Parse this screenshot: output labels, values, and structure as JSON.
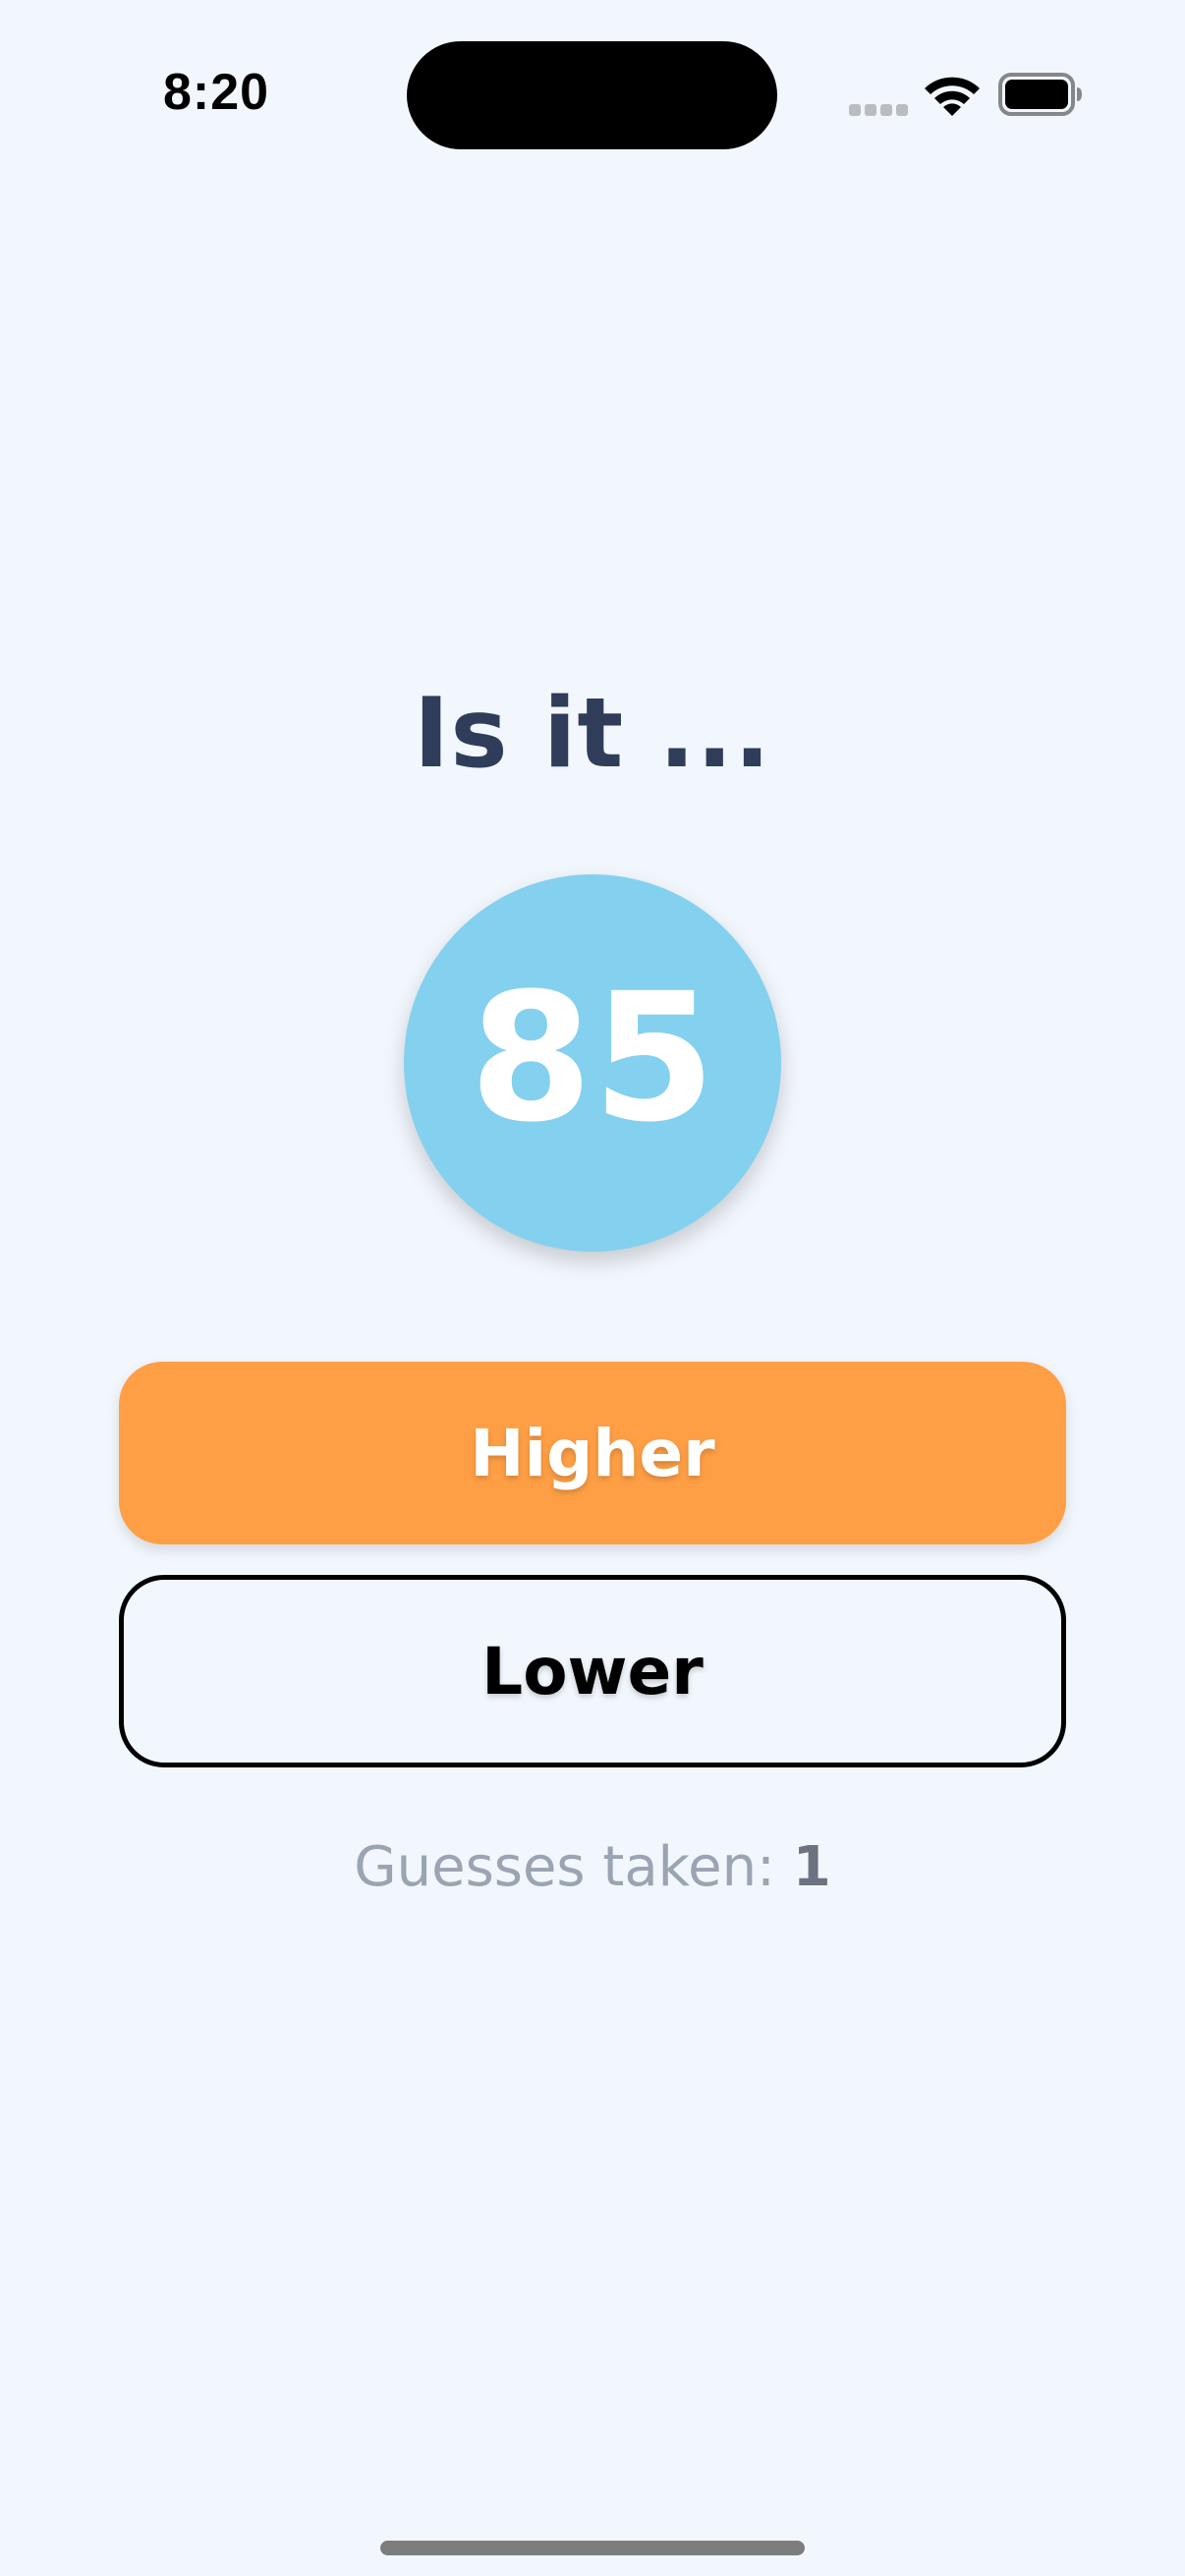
{
  "status_bar": {
    "time": "8:20",
    "icons": [
      "cellular-signal-icon",
      "wifi-icon",
      "battery-icon"
    ]
  },
  "game": {
    "prompt": "Is it ...",
    "guess_number": "85",
    "higher_label": "Higher",
    "lower_label": "Lower",
    "guesses_label": "Guesses taken:",
    "guesses_count": "1"
  },
  "colors": {
    "background": "#f2f7fd",
    "circle": "#84d0ef",
    "higher_button": "#ff9f45",
    "prompt_text": "#2f3d5a",
    "muted_text": "#9aa4b3"
  }
}
